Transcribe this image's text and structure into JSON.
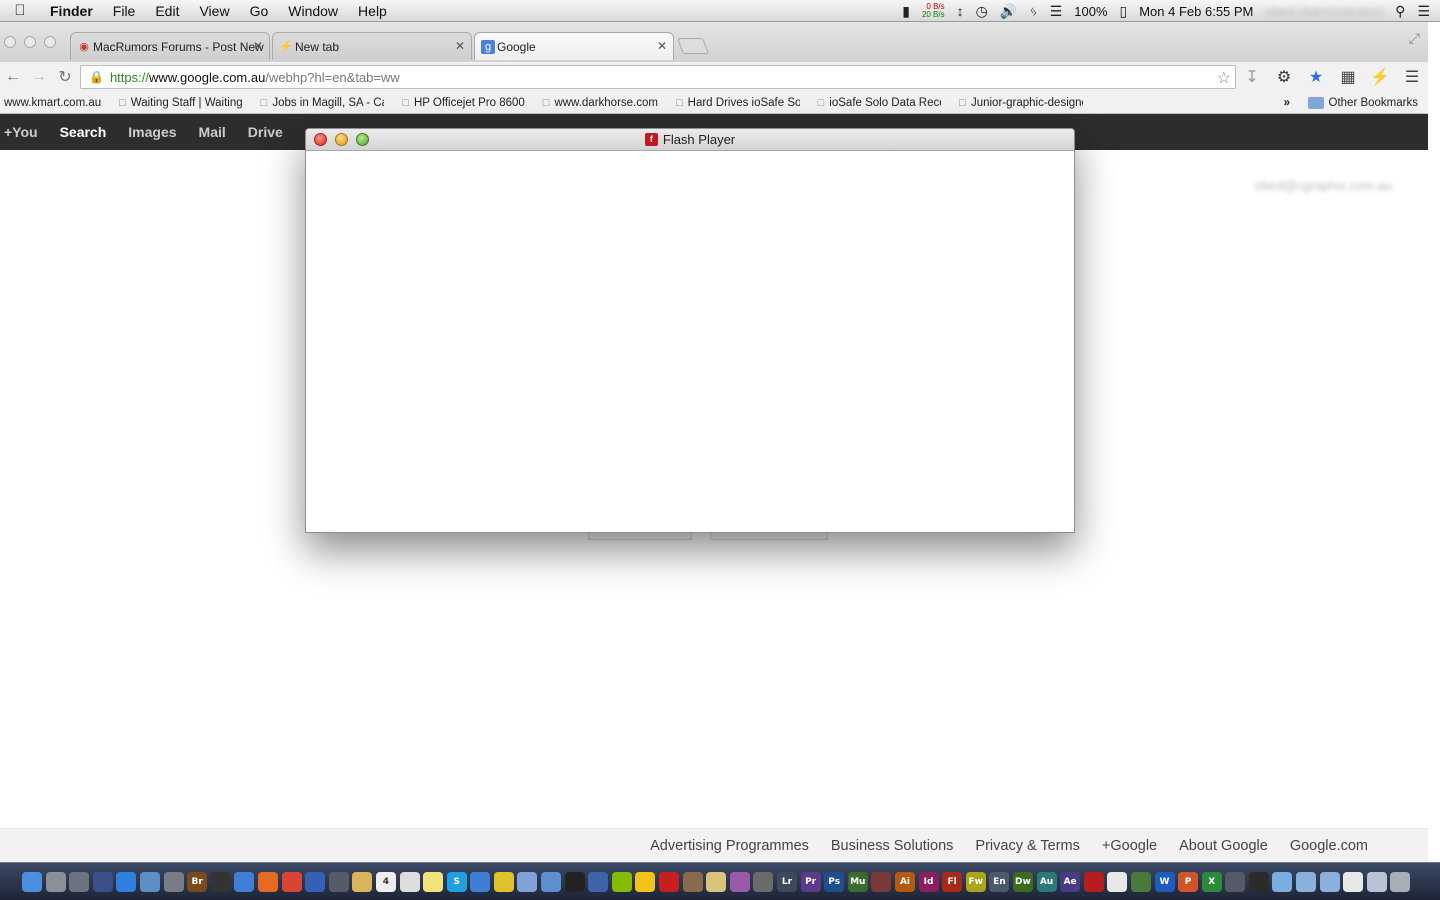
{
  "menubar": {
    "app_name": "Finder",
    "menus": [
      "File",
      "Edit",
      "View",
      "Go",
      "Window",
      "Help"
    ],
    "net_up": "0 B/s",
    "net_down": "20 B/s",
    "battery": "100%",
    "datetime": "Mon 4 Feb  6:55 PM",
    "username": "obed (Administrator)"
  },
  "browser": {
    "tabs": [
      {
        "label": "MacRumors Forums - Post New",
        "favicon": "macrumors-icon"
      },
      {
        "label": "New tab",
        "favicon": "lightning-icon"
      },
      {
        "label": "Google",
        "favicon": "google-icon"
      }
    ],
    "active_tab": 2,
    "url_scheme": "https://",
    "url_host": "www.google.com.au",
    "url_path": "/webhp?hl=en&tab=ww",
    "bookmarks": [
      "www.kmart.com.au",
      "Waiting Staff | Waiting",
      "Jobs in Magill, SA - Careers",
      "HP Officejet Pro 8600",
      "www.darkhorse.com",
      "Hard Drives ioSafe Solo",
      "ioSafe Solo Data Recovery",
      "Junior-graphic-designer"
    ],
    "overflow_label": "»",
    "other_bookmarks": "Other Bookmarks"
  },
  "google": {
    "nav": [
      "+You",
      "Search",
      "Images",
      "Mail",
      "Drive"
    ],
    "active_nav": "Search",
    "account_email": "obed@cgraphix.com.au",
    "footer_links": [
      "Advertising Programmes",
      "Business Solutions",
      "Privacy & Terms",
      "+Google",
      "About Google",
      "Google.com"
    ]
  },
  "flash_window": {
    "title": "Flash Player",
    "logo_letter": "f"
  },
  "dock": {
    "apps": [
      {
        "name": "finder-icon",
        "color": "#4a8fe0",
        "glyph": ""
      },
      {
        "name": "launchpad-icon",
        "color": "#8a8f99",
        "glyph": ""
      },
      {
        "name": "utility-icon",
        "color": "#6d7280",
        "glyph": ""
      },
      {
        "name": "mission-control-icon",
        "color": "#3b4f8a",
        "glyph": ""
      },
      {
        "name": "app-store-icon",
        "color": "#2f7fdc",
        "glyph": ""
      },
      {
        "name": "preview-icon",
        "color": "#5d8fc6",
        "glyph": ""
      },
      {
        "name": "system-app-icon",
        "color": "#777c86",
        "glyph": ""
      },
      {
        "name": "bridge-icon",
        "color": "#7a4a1e",
        "glyph": "Br"
      },
      {
        "name": "dvd-player-icon",
        "color": "#333333",
        "glyph": ""
      },
      {
        "name": "safari-icon",
        "color": "#3f7fd6",
        "glyph": ""
      },
      {
        "name": "firefox-icon",
        "color": "#e66a1f",
        "glyph": ""
      },
      {
        "name": "chrome-icon",
        "color": "#d94535",
        "glyph": ""
      },
      {
        "name": "thunderbird-icon",
        "color": "#3461b4",
        "glyph": ""
      },
      {
        "name": "photo-booth-icon",
        "color": "#555b67",
        "glyph": ""
      },
      {
        "name": "notes-icon",
        "color": "#d8b45a",
        "glyph": ""
      },
      {
        "name": "calendar-icon",
        "color": "#eeeeee",
        "glyph": "4"
      },
      {
        "name": "textedit-icon",
        "color": "#dddddd",
        "glyph": ""
      },
      {
        "name": "stickies-icon",
        "color": "#f2e27a",
        "glyph": ""
      },
      {
        "name": "skype-icon",
        "color": "#1fa0e3",
        "glyph": "S"
      },
      {
        "name": "itunes-icon",
        "color": "#3e7ed6",
        "glyph": ""
      },
      {
        "name": "radiation-icon",
        "color": "#e2c22a",
        "glyph": ""
      },
      {
        "name": "cyberduck-icon",
        "color": "#7fa3d8",
        "glyph": ""
      },
      {
        "name": "mail-icon",
        "color": "#5c8fd0",
        "glyph": ""
      },
      {
        "name": "quill-icon",
        "color": "#222222",
        "glyph": ""
      },
      {
        "name": "quicktime-icon",
        "color": "#3d63a8",
        "glyph": ""
      },
      {
        "name": "spotify-icon",
        "color": "#84bd00",
        "glyph": ""
      },
      {
        "name": "adium-icon",
        "color": "#f2c21a",
        "glyph": ""
      },
      {
        "name": "acrobat-icon",
        "color": "#c71f1f",
        "glyph": ""
      },
      {
        "name": "transmission-icon",
        "color": "#8a6a4a",
        "glyph": ""
      },
      {
        "name": "star-app-icon",
        "color": "#d9c47a",
        "glyph": ""
      },
      {
        "name": "font-book-icon",
        "color": "#9b5aa8",
        "glyph": ""
      },
      {
        "name": "brush-icon",
        "color": "#6b6b6b",
        "glyph": ""
      },
      {
        "name": "lightroom-icon",
        "color": "#3c4a5e",
        "glyph": "Lr"
      },
      {
        "name": "premiere-icon",
        "color": "#5a3a8a",
        "glyph": "Pr"
      },
      {
        "name": "photoshop-icon",
        "color": "#1d4f8f",
        "glyph": "Ps"
      },
      {
        "name": "muse-icon",
        "color": "#3d6b2e",
        "glyph": "Mu"
      },
      {
        "name": "app-icon",
        "color": "#7a3a3a",
        "glyph": ""
      },
      {
        "name": "illustrator-icon",
        "color": "#b35a0f",
        "glyph": "Ai"
      },
      {
        "name": "indesign-icon",
        "color": "#8a1f5c",
        "glyph": "Id"
      },
      {
        "name": "flash-icon",
        "color": "#a8281a",
        "glyph": "Fl"
      },
      {
        "name": "fireworks-icon",
        "color": "#a9a61a",
        "glyph": "Fw"
      },
      {
        "name": "encore-icon",
        "color": "#4a5a6a",
        "glyph": "En"
      },
      {
        "name": "dreamweaver-icon",
        "color": "#3d6b1e",
        "glyph": "Dw"
      },
      {
        "name": "audition-icon",
        "color": "#2a7a7a",
        "glyph": "Au"
      },
      {
        "name": "after-effects-icon",
        "color": "#4a3a8a",
        "glyph": "Ae"
      },
      {
        "name": "acrobat-pro-icon",
        "color": "#b71d1d",
        "glyph": ""
      },
      {
        "name": "pdf-icon",
        "color": "#e8e8e8",
        "glyph": ""
      },
      {
        "name": "terminal-icon",
        "color": "#4a7a3a",
        "glyph": ""
      },
      {
        "name": "word-icon",
        "color": "#1f5bbd",
        "glyph": "W"
      },
      {
        "name": "powerpoint-icon",
        "color": "#d2552a",
        "glyph": "P"
      },
      {
        "name": "excel-icon",
        "color": "#2a8a3a",
        "glyph": "X"
      },
      {
        "name": "utility-2-icon",
        "color": "#555a66",
        "glyph": ""
      },
      {
        "name": "camera-icon",
        "color": "#2b2b2b",
        "glyph": ""
      },
      {
        "name": "network-icon",
        "color": "#7aaee0",
        "glyph": ""
      },
      {
        "name": "applications-folder-icon",
        "color": "#8ab0de",
        "glyph": ""
      },
      {
        "name": "documents-folder-icon",
        "color": "#8ab0de",
        "glyph": ""
      },
      {
        "name": "document-icon",
        "color": "#e8e8e8",
        "glyph": ""
      },
      {
        "name": "downloads-icon",
        "color": "#b8c4d6",
        "glyph": ""
      },
      {
        "name": "trash-icon",
        "color": "#a8aeb8",
        "glyph": ""
      }
    ]
  }
}
